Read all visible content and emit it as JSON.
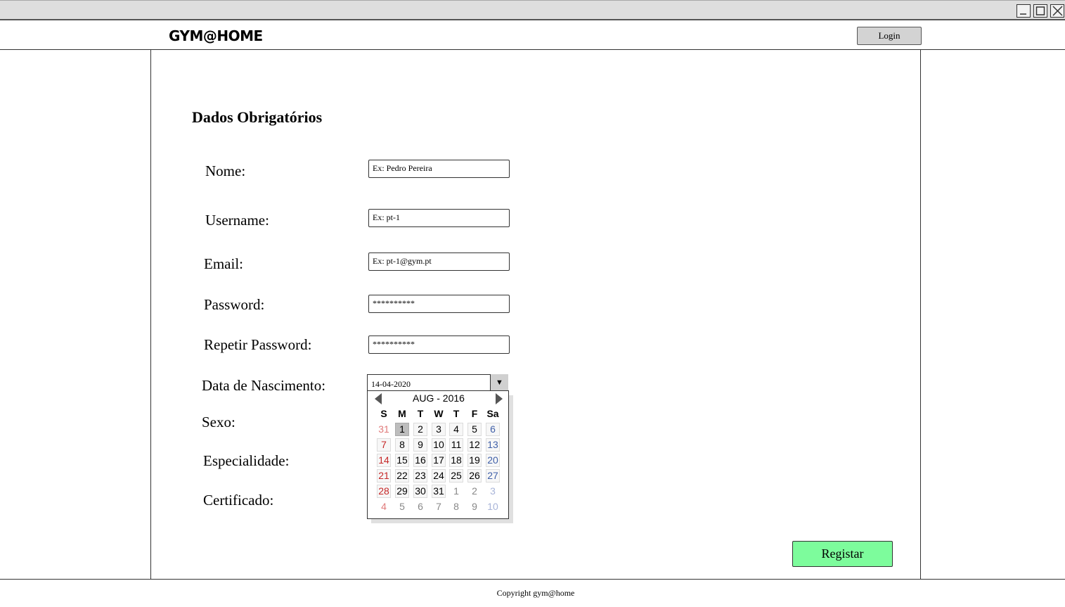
{
  "window": {
    "minimize_icon": "minimize-icon",
    "maximize_icon": "maximize-icon",
    "close_icon": "close-icon"
  },
  "header": {
    "logo": "GYM@HOME",
    "login_label": "Login"
  },
  "form": {
    "title": "Dados Obrigatórios",
    "nome_label": "Nome:",
    "nome_placeholder": "Ex: Pedro Pereira",
    "username_label": "Username:",
    "username_placeholder": "Ex: pt-1",
    "email_label": "Email:",
    "email_placeholder": "Ex: pt-1@gym.pt",
    "password_label": "Password:",
    "password_value": "**********",
    "repeat_password_label": "Repetir Password:",
    "repeat_password_value": "**********",
    "birthdate_label": "Data de Nascimento:",
    "birthdate_value": "14-04-2020",
    "sexo_label": "Sexo:",
    "especialidade_label": "Especialidade:",
    "certificado_label": "Certificado:",
    "submit_label": "Registar"
  },
  "calendar": {
    "month_label": "AUG - 2016",
    "weekdays": [
      "S",
      "M",
      "T",
      "W",
      "T",
      "F",
      "Sa"
    ],
    "selected_day": "1",
    "weeks": [
      [
        "31",
        "1",
        "2",
        "3",
        "4",
        "5",
        "6"
      ],
      [
        "7",
        "8",
        "9",
        "10",
        "11",
        "12",
        "13"
      ],
      [
        "14",
        "15",
        "16",
        "17",
        "18",
        "19",
        "20"
      ],
      [
        "21",
        "22",
        "23",
        "24",
        "25",
        "26",
        "27"
      ],
      [
        "28",
        "29",
        "30",
        "31",
        "1",
        "2",
        "3"
      ],
      [
        "4",
        "5",
        "6",
        "7",
        "8",
        "9",
        "10"
      ]
    ]
  },
  "footer": {
    "copyright": "Copyright gym@home"
  }
}
